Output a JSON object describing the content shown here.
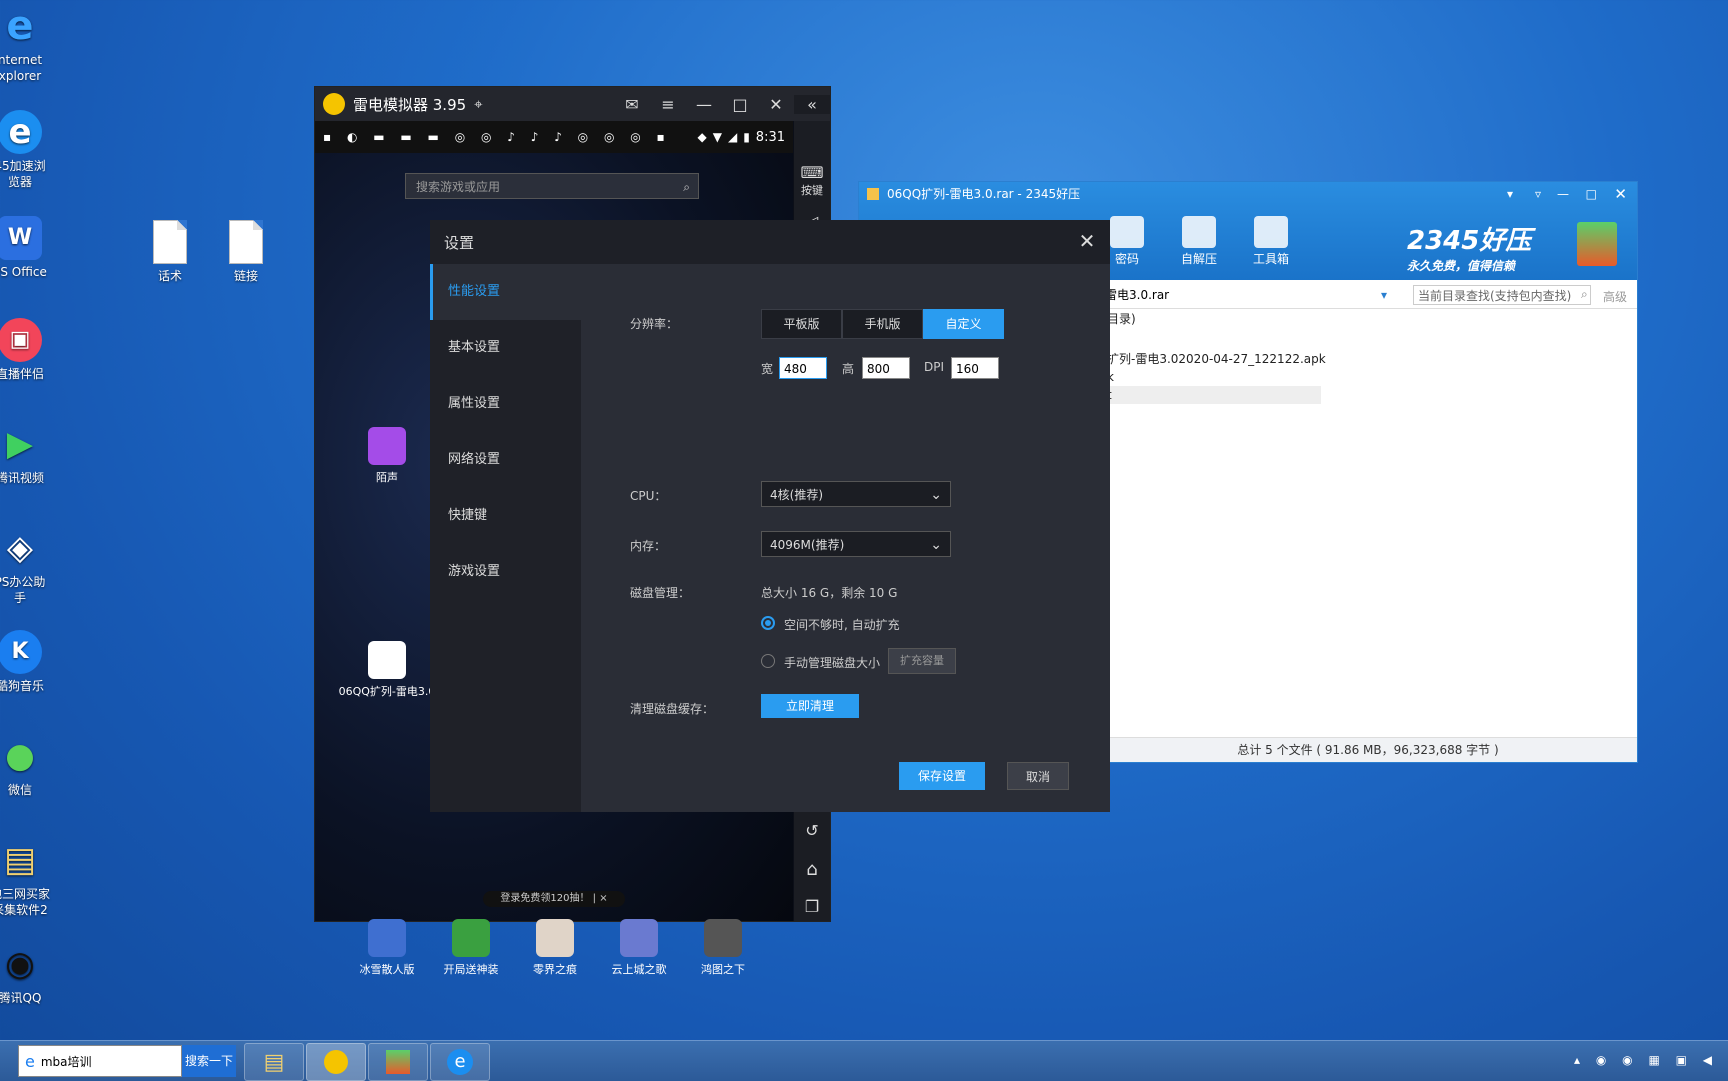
{
  "desktop": {
    "icons": [
      {
        "label": "nternet\nxplorer"
      },
      {
        "label": "45加速浏\n览器"
      },
      {
        "label": "PS Office"
      },
      {
        "label": "直播伴侣"
      },
      {
        "label": "腾讯视频"
      },
      {
        "label": "PS办公助\n手"
      },
      {
        "label": "酷狗音乐"
      },
      {
        "label": "微信"
      },
      {
        "label": "地三网买家\n采集软件2"
      },
      {
        "label": "腾讯QQ"
      },
      {
        "label": "话术"
      },
      {
        "label": "链接"
      }
    ]
  },
  "emulator": {
    "title": "雷电模拟器 3.95",
    "time": "8:31",
    "search_placeholder": "搜索游戏或应用",
    "side_keys_label": "按键",
    "desktop_apps": [
      {
        "label": "陌声"
      },
      {
        "label": "06QQ扩列-雷电3.0"
      }
    ],
    "banner": "登录免费领120抽！ | ×",
    "dock_apps": [
      {
        "label": "冰雪散人版"
      },
      {
        "label": "开局送神装"
      },
      {
        "label": "零界之痕"
      },
      {
        "label": "云上城之歌"
      },
      {
        "label": "鸿图之下"
      }
    ]
  },
  "settings": {
    "title": "设置",
    "nav": [
      {
        "label": "性能设置",
        "active": true
      },
      {
        "label": "基本设置",
        "active": false
      },
      {
        "label": "属性设置",
        "active": false
      },
      {
        "label": "网络设置",
        "active": false
      },
      {
        "label": "快捷键",
        "active": false
      },
      {
        "label": "游戏设置",
        "active": false
      }
    ],
    "resolution_label": "分辨率：",
    "resolution_options": [
      "平板版",
      "手机版",
      "自定义"
    ],
    "resolution_selected": "自定义",
    "width_label": "宽",
    "width_value": "480",
    "height_label": "高",
    "height_value": "800",
    "dpi_label": "DPI",
    "dpi_value": "160",
    "cpu_label": "CPU：",
    "cpu_value": "4核(推荐)",
    "memory_label": "内存：",
    "memory_value": "4096M(推荐)",
    "disk_label": "磁盘管理：",
    "disk_info": "总大小 16 G，剩余 10 G",
    "disk_opt_auto": "空间不够时, 自动扩充",
    "disk_opt_manual": "手动管理磁盘大小",
    "expand_button": "扩充容量",
    "clear_cache_label": "清理磁盘缓存：",
    "clear_button": "立即清理",
    "save_button": "保存设置",
    "cancel_button": "取消"
  },
  "zip": {
    "title": "06QQ扩列-雷电3.0.rar - 2345好压",
    "tools": [
      {
        "label": "密码"
      },
      {
        "label": "自解压"
      },
      {
        "label": "工具箱"
      }
    ],
    "brand": "2345好压",
    "slogan": "永久免费，值得信赖",
    "path": "雷电3.0.rar",
    "search_placeholder": "当前目录查找(支持包内查找)",
    "advanced": "高级",
    "rows": [
      "目录)",
      "扩列-雷电3.02020-04-27_122122.apk",
      "k",
      "t"
    ],
    "status": "总计 5 个文件 ( 91.86 MB，96,323,688 字节 )"
  },
  "taskbar": {
    "search_value": "mba培训",
    "search_button": "搜索一下"
  }
}
